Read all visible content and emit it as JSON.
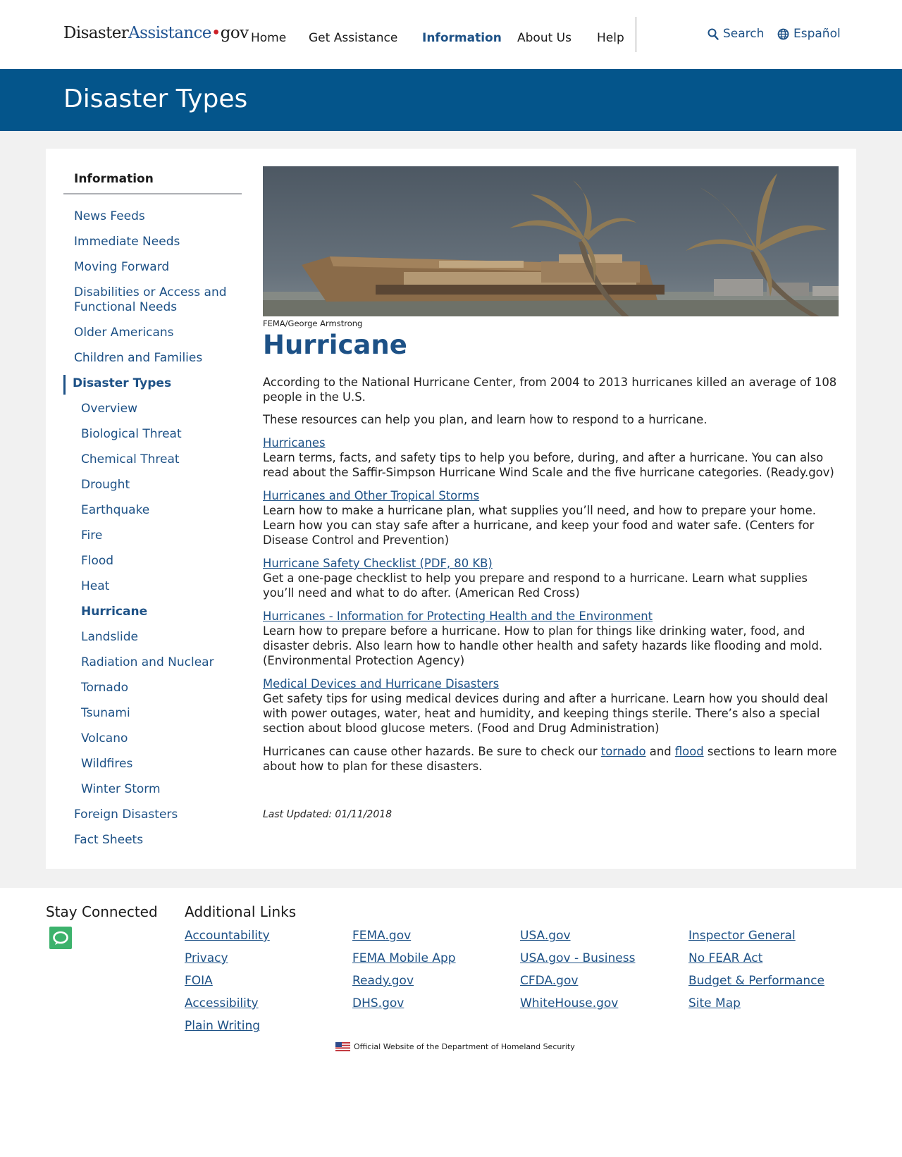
{
  "header": {
    "logo": {
      "part1": "Disaster",
      "part2": "Assistance",
      "dot": "•",
      "part3": "gov"
    },
    "nav": [
      "Home",
      "Get Assistance",
      "Information",
      "About Us",
      "Help"
    ],
    "active_nav": "Information",
    "search_label": "Search",
    "language_label": "Español"
  },
  "banner": {
    "title": "Disaster Types"
  },
  "sidebar": {
    "title": "Information",
    "items_top": [
      "News Feeds",
      "Immediate Needs",
      "Moving Forward",
      "Disabilities or Access and Functional Needs",
      "Older Americans",
      "Children and Families"
    ],
    "section": "Disaster Types",
    "sub_items": [
      "Overview",
      "Biological Threat",
      "Chemical Threat",
      "Drought",
      "Earthquake",
      "Fire",
      "Flood",
      "Heat",
      "Hurricane",
      "Landslide",
      "Radiation and Nuclear",
      "Tornado",
      "Tsunami",
      "Volcano",
      "Wildfires",
      "Winter Storm"
    ],
    "current": "Hurricane",
    "items_bottom": [
      "Foreign Disasters",
      "Fact Sheets"
    ]
  },
  "main": {
    "image_caption": "FEMA/George Armstrong",
    "title": "Hurricane",
    "intro": "According to the National Hurricane Center, from 2004 to 2013 hurricanes killed an average of 108 people in the U.S.",
    "intro2": "These resources can help you plan, and learn how to respond to a hurricane.",
    "resources": [
      {
        "link": "Hurricanes",
        "text": "Learn terms, facts, and safety tips to help you before, during, and after a hurricane. You can also read about the Saffir-Simpson Hurricane Wind Scale and the five hurricane categories. (Ready.gov)"
      },
      {
        "link": "Hurricanes and Other Tropical Storms",
        "text": "Learn how to make a hurricane plan, what supplies you’ll need, and how to prepare your home. Learn how you can stay safe after a hurricane, and keep your food and water safe. (Centers for Disease Control and Prevention)"
      },
      {
        "link": "Hurricane Safety Checklist (PDF, 80 KB)",
        "text": "Get a one-page checklist to help you prepare and respond to a hurricane. Learn what supplies you’ll need and what to do after. (American Red Cross)"
      },
      {
        "link": "Hurricanes - Information for Protecting Health and the Environment",
        "text": "Learn how to prepare before a hurricane. How to plan for things like drinking water, food,  and disaster debris. Also learn how to handle other health and safety hazards like flooding and mold. (Environmental Protection Agency)"
      },
      {
        "link": "Medical Devices and Hurricane Disasters",
        "text": "Get safety tips for using medical devices during and after a hurricane. Learn how you should deal with power outages, water, heat and humidity, and keeping things sterile. There’s also a special section about blood glucose meters. (Food and Drug Administration)"
      }
    ],
    "closing": {
      "before": "Hurricanes can cause other hazards. Be sure to check our ",
      "link1": "tornado",
      "between": " and ",
      "link2": "flood",
      "after": " sections to learn more about how to plan for these disasters."
    },
    "last_updated": "Last Updated: 01/11/2018"
  },
  "footer": {
    "stay_connected": "Stay Connected",
    "additional_links": "Additional Links",
    "columns": [
      [
        "Accountability",
        "Privacy",
        "FOIA",
        "Accessibility",
        "Plain Writing"
      ],
      [
        "FEMA.gov",
        "FEMA Mobile App",
        "Ready.gov",
        "DHS.gov"
      ],
      [
        "USA.gov",
        "USA.gov - Business",
        "CFDA.gov",
        "WhiteHouse.gov"
      ],
      [
        "Inspector General",
        "No FEAR Act",
        "Budget & Performance",
        "Site Map"
      ]
    ],
    "official": "Official Website of the Department of Homeland Security"
  },
  "colors": {
    "brand_blue": "#04558b",
    "link": "#1d5186",
    "gray_bg": "#f1f1f1",
    "chat_green": "#3cb26c"
  },
  "icons": [
    "search-icon",
    "globe-icon",
    "chat-icon",
    "us-flag-icon"
  ]
}
